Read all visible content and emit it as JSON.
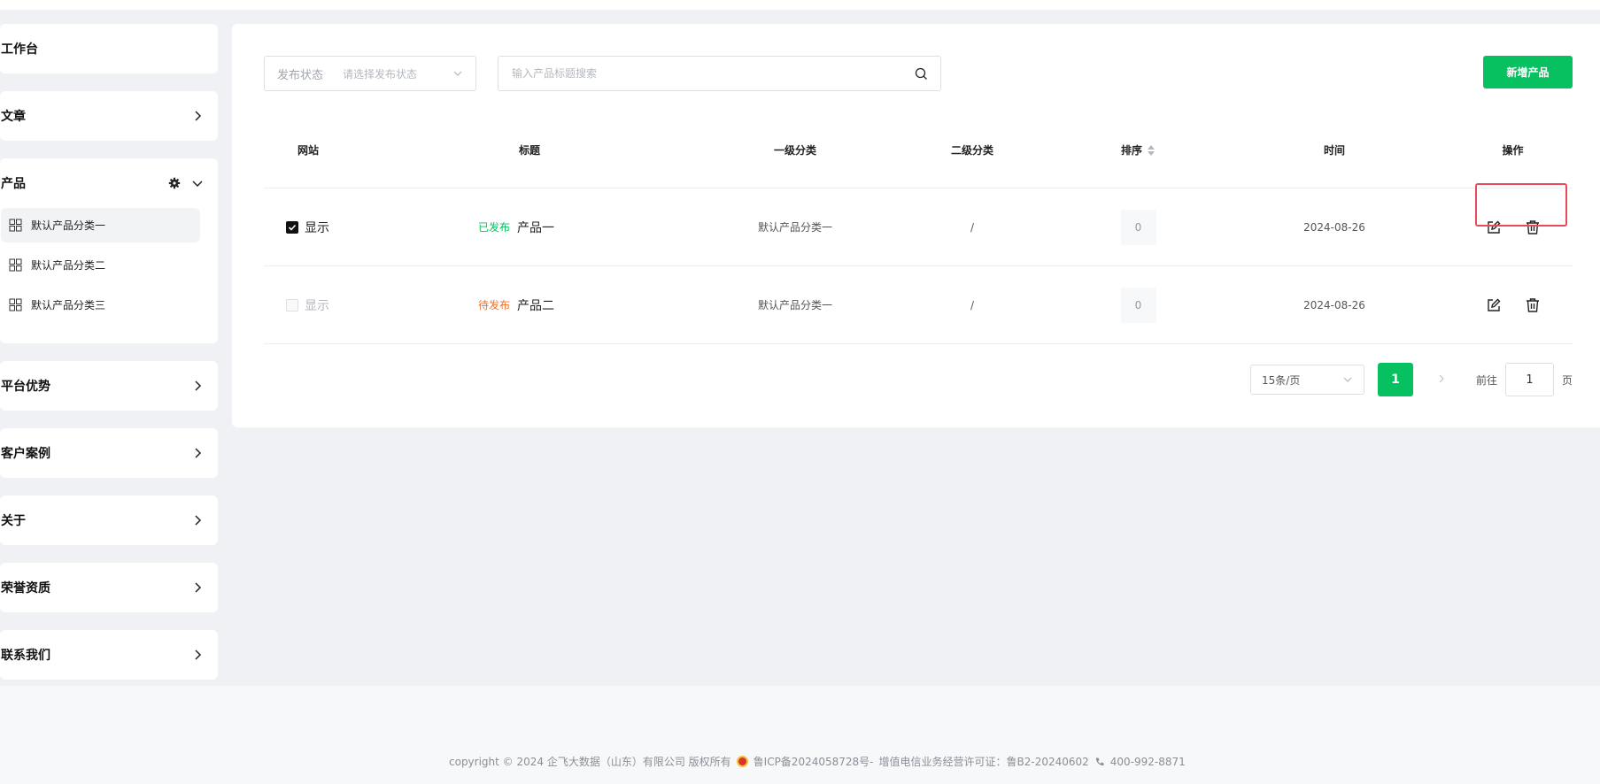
{
  "sidebar": {
    "items": [
      {
        "label": "工作台"
      },
      {
        "label": "文章"
      },
      {
        "label": "产品",
        "sub": [
          "默认产品分类一",
          "默认产品分类二",
          "默认产品分类三"
        ]
      },
      {
        "label": "平台优势"
      },
      {
        "label": "客户案例"
      },
      {
        "label": "关于"
      },
      {
        "label": "荣誉资质"
      },
      {
        "label": "联系我们"
      }
    ]
  },
  "filters": {
    "status_label": "发布状态",
    "status_placeholder": "请选择发布状态",
    "search_placeholder": "输入产品标题搜索",
    "add_button": "新增产品"
  },
  "table": {
    "headers": [
      "网站",
      "标题",
      "一级分类",
      "二级分类",
      "排序",
      "时间",
      "操作"
    ],
    "rows": [
      {
        "site_label": "显示",
        "site_checked": true,
        "status": "已发布",
        "title": "产品一",
        "cat1": "默认产品分类一",
        "cat2": "/",
        "sort": "0",
        "date": "2024-08-26"
      },
      {
        "site_label": "显示",
        "site_checked": false,
        "status": "待发布",
        "title": "产品二",
        "cat1": "默认产品分类一",
        "cat2": "/",
        "sort": "0",
        "date": "2024-08-26"
      }
    ]
  },
  "pagination": {
    "page_size": "15条/页",
    "current_page": "1",
    "goto_label": "前往",
    "goto_value": "1",
    "goto_suffix": "页"
  },
  "footer": {
    "copyright": "copyright © 2024 企飞大数据（山东）有限公司 版权所有",
    "icp": "鲁ICP备2024058728号-",
    "license": "增值电信业务经营许可证：鲁B2-20240602",
    "phone": "400-992-8871"
  },
  "colors": {
    "accent": "#07c160",
    "pending": "#f0722b",
    "highlight": "#e84b5a"
  }
}
